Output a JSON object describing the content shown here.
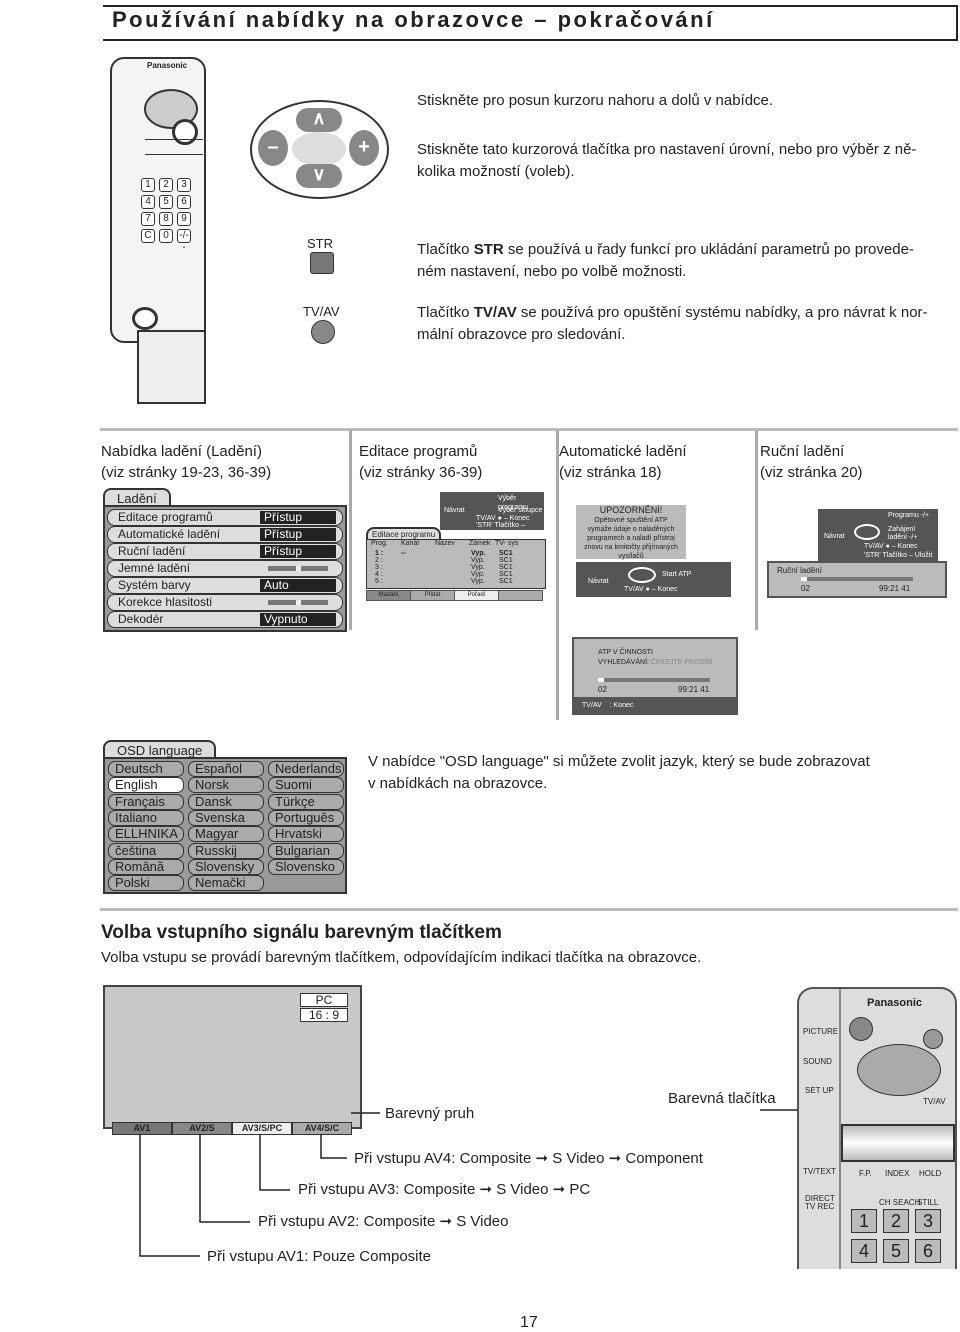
{
  "title": "Používání nabídky na obrazovce – pokračování",
  "remote_top": {
    "brand": "Panasonic",
    "keys": [
      "1",
      "2",
      "3",
      "4",
      "5",
      "6",
      "7",
      "8",
      "9",
      "C",
      "0",
      "-/--"
    ]
  },
  "cursor_buttons": {
    "up": "∧",
    "down": "∨",
    "minus": "–",
    "plus": "+"
  },
  "str_label": "STR",
  "tvav_label": "TV/AV",
  "instructions": [
    {
      "text": "Stiskněte pro posun kurzoru nahoru a dolů v nabídce."
    },
    {
      "line1": "Stiskněte tato kurzorová tlačítka pro nastavení úrovní, nebo pro výběr z ně-",
      "line2": "kolika možností (voleb)."
    },
    {
      "pre": "Tlačítko ",
      "bold": "STR",
      "post": " se používá u řady funkcí pro ukládání parametrů po provede-",
      "line2": "ném nastavení, nebo po volbě možnosti."
    },
    {
      "pre": "Tlačítko ",
      "bold": "TV/AV",
      "post": " se používá pro opuštění systému nabídky, a pro návrat k nor-",
      "line2": "mální obrazovce pro sledování."
    }
  ],
  "sections": [
    {
      "h1": "Nabídka ladění (Ladění)",
      "h2": "(viz stránky 19-23, 36-39)"
    },
    {
      "h1": "Editace programů",
      "h2": "(viz stránky 36-39)"
    },
    {
      "h1": "Automatické ladění",
      "h2": "(viz stránka 18)"
    },
    {
      "h1": "Ruční ladění",
      "h2": "(viz stránka 20)"
    }
  ],
  "tuning_menu": {
    "tab": "Ladění",
    "rows": [
      {
        "label": "Editace programů",
        "value": "Přístup"
      },
      {
        "label": "Automatické ladění",
        "value": "Přístup"
      },
      {
        "label": "Ruční ladění",
        "value": "Přístup"
      },
      {
        "label": "Jemné ladění",
        "slider": 0.5
      },
      {
        "label": "Systém barvy",
        "value": "Auto"
      },
      {
        "label": "Korekce hlasitosti",
        "slider": 0.5
      },
      {
        "label": "Dekodér",
        "value": "Vypnuto"
      }
    ]
  },
  "prog_edit": {
    "help": {
      "back": "Návrat",
      "select_prog": "Výběr programu",
      "select_col": "Výběr sloupce",
      "exit": "TV/AV ● – Konec",
      "store": "'STR' Tlačítko – Uložit"
    },
    "tab": "Editace programu",
    "columns": [
      "Prog.",
      "Kanál",
      "Název",
      "Zámek",
      "TV- sys"
    ],
    "rows": [
      [
        "1 :",
        "--",
        "",
        "Vyp.",
        "SC1"
      ],
      [
        "2 :",
        "",
        "",
        "Vyp.",
        "SC1"
      ],
      [
        "3 :",
        "",
        "",
        "Vyp.",
        "SC1"
      ],
      [
        "4 :",
        "",
        "",
        "Vyp.",
        "SC1"
      ],
      [
        "5 :",
        "",
        "",
        "Vyp.",
        "SC1"
      ]
    ],
    "buttons": [
      "Mazání",
      "Přidat",
      "Pořadí",
      ""
    ]
  },
  "auto_tuning": {
    "warning_title": "UPOZORNĚNÍ!",
    "warning_text": [
      "Opětovné spuštění ATP",
      "vymaže údaje o naladěných",
      "programech a naladí přístroj",
      "znovu na kmitočty přijímaných",
      "vysílačů"
    ],
    "back": "Návrat",
    "start": "Start ATP",
    "exit": "TV/AV ● – Konec"
  },
  "manual_tuning": {
    "program": "Programu -/+",
    "start": "Zahájení",
    "start2": "ladění -/+",
    "back": "Návrat",
    "exit": "TV/AV ● – Konec",
    "store": "'STR' Tlačítko – Uložit",
    "title": "Ruční ladění",
    "channel": "02",
    "freq": "99:21 41",
    "progress": 0.05
  },
  "atp": {
    "line1": "ATP V ČINNOSTI",
    "line2a": "VYHLEDÁVÁNÍ:",
    "line2b": "ČEKEJTE PROSÍM",
    "channel": "02",
    "freq": "99:21 41",
    "progress": 0.05,
    "footer_key": "TV/AV",
    "footer_text": ": Konec"
  },
  "osd": {
    "tab": "OSD language",
    "selected": "English",
    "columns": [
      [
        "Deutsch",
        "English",
        "Français",
        "Italiano",
        "ELLHNIKA",
        "čeština",
        "Română",
        "Polski"
      ],
      [
        "Español",
        "Norsk",
        "Dansk",
        "Svenska",
        "Magyar",
        "Russkij",
        "Slovensky",
        "Nemački"
      ],
      [
        "Nederlands",
        "Suomi",
        "Türkçe",
        "Português",
        "Hrvatski",
        "Bulgarian",
        "Slovensko"
      ]
    ],
    "desc1": "V nabídce \"OSD language\" si můžete zvolit jazyk, který se bude zobrazovat",
    "desc2": "v nabídkách na obrazovce."
  },
  "input_section": {
    "heading": "Volba vstupního signálu barevným tlačítkem",
    "sub": "Volba vstupu se provádí barevným tlačítkem, odpovídajícím indikaci tlačítka na obrazovce.",
    "screen": {
      "mode": "PC",
      "aspect": "16 : 9",
      "bar": [
        "AV1",
        "AV2/S",
        "AV3/S/PC",
        "AV4/S/C"
      ]
    },
    "color_bar_label": "Barevný pruh",
    "color_buttons_label": "Barevná tlačítka",
    "notes": [
      "Při vstupu AV4: Composite ➞ S Video ➞ Component",
      "Při vstupu AV3: Composite ➞ S Video ➞ PC",
      "Při vstupu AV2: Composite ➞ S Video",
      "Při vstupu AV1: Pouze Composite"
    ]
  },
  "remote_bottom": {
    "brand": "Panasonic",
    "picture": "PICTURE",
    "sound": "SOUND",
    "setup": "SET UP",
    "tvav": "TV/AV",
    "tvtext": "TV/TEXT",
    "fp": "F.P.",
    "index": "INDEX",
    "hold": "HOLD",
    "direct": "DIRECT",
    "tvrec": "TV REC",
    "chsearch": "CH SEACH",
    "still": "STILL",
    "keys": [
      "1",
      "2",
      "3",
      "4",
      "5",
      "6"
    ]
  },
  "page_number": "17"
}
